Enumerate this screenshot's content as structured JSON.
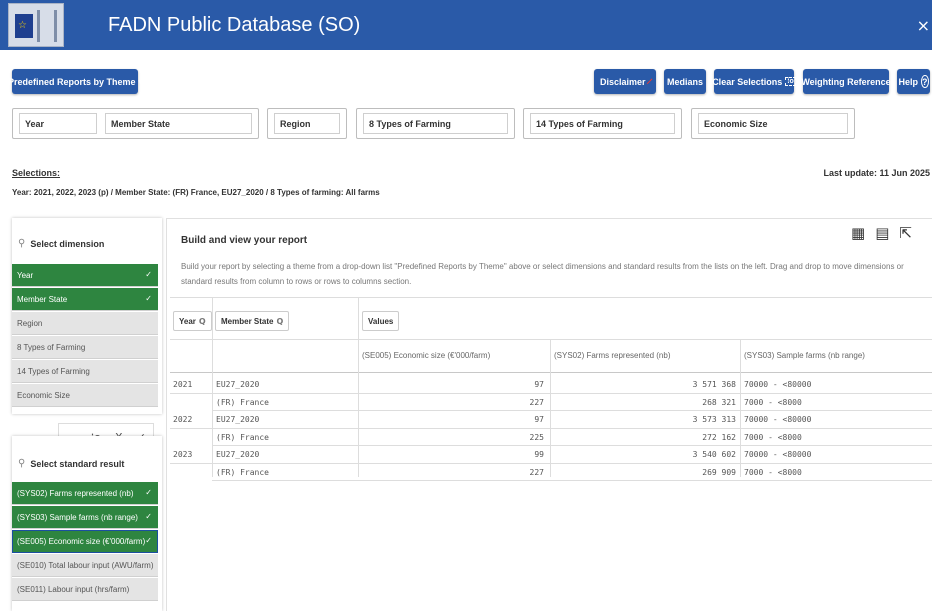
{
  "app": {
    "title": "FADN Public Database (SO)",
    "close": "×"
  },
  "toolbar": {
    "predefined": "Predefined Reports by Theme",
    "disclaimer": "Disclaimer",
    "medians": "Medians",
    "clear": "Clear Selections",
    "weighting": "Weighting Reference",
    "help": "Help",
    "help_icon": "?",
    "caret": "▾",
    "clear_icon": "⁞o"
  },
  "filters": [
    "Year",
    "Member State",
    "Region",
    "8 Types of Farming",
    "14 Types of Farming",
    "Economic Size"
  ],
  "selections": {
    "label": "Selections:",
    "text": "Year: 2021, 2022, 2023 (p) / Member State: (FR) France, EU27_2020 / 8 Types of farming: All farms",
    "last_update": "Last update: 11 Jun 2025"
  },
  "dimensions": {
    "search_label": "Select dimension",
    "items": [
      {
        "label": "Year",
        "selected": true
      },
      {
        "label": "Member State",
        "selected": true
      },
      {
        "label": "Region",
        "selected": false
      },
      {
        "label": "8 Types of Farming",
        "selected": false
      },
      {
        "label": "14 Types of Farming",
        "selected": false
      },
      {
        "label": "Economic Size",
        "selected": false
      }
    ]
  },
  "mini_toolbar": {
    "more": "···",
    "select": "⁞o",
    "close": "X",
    "confirm": "✓"
  },
  "results": {
    "search_label": "Select standard result",
    "items": [
      {
        "label": "(SYS02) Farms represented (nb)",
        "selected": true
      },
      {
        "label": "(SYS03) Sample farms (nb range)",
        "selected": true
      },
      {
        "label": "(SE005) Economic size (€'000/farm)",
        "selected": true
      },
      {
        "label": "(SE010) Total labour input (AWU/farm)",
        "selected": false
      },
      {
        "label": "(SE011) Labour input (hrs/farm)",
        "selected": false
      }
    ]
  },
  "report": {
    "title": "Build and view your report",
    "description": "Build your report by selecting a theme from a drop-down list \"Predefined Reports by Theme\" above or select dimensions and standard results from the lists on the left. Drag and drop to move dimensions or standard results from column to rows or rows to columns section.",
    "pills": {
      "year": "Year",
      "member_state": "Member State",
      "values": "Values"
    },
    "columns": [
      "(SE005) Economic size (€'000/farm)",
      "(SYS02) Farms represented (nb)",
      "(SYS03) Sample farms (nb range)"
    ],
    "rows": [
      {
        "year": "2021",
        "state": "EU27_2020",
        "se005": "97",
        "sys02": "3 571 368",
        "sys03": "70000 - <80000"
      },
      {
        "year": "",
        "state": "(FR) France",
        "se005": "227",
        "sys02": "268 321",
        "sys03": "7000 - <8000"
      },
      {
        "year": "2022",
        "state": "EU27_2020",
        "se005": "97",
        "sys02": "3 573 313",
        "sys03": "70000 - <80000"
      },
      {
        "year": "",
        "state": "(FR) France",
        "se005": "225",
        "sys02": "272 162",
        "sys03": "7000 - <8000"
      },
      {
        "year": "2023",
        "state": "EU27_2020",
        "se005": "99",
        "sys02": "3 540 602",
        "sys03": "70000 - <80000"
      },
      {
        "year": "",
        "state": "(FR) France",
        "se005": "227",
        "sys02": "269 909",
        "sys03": "7000 - <8000"
      }
    ]
  },
  "icons": {
    "search": "⚲",
    "magnifier": "Q",
    "table_a": "▦",
    "table_b": "▤",
    "export": "⇱"
  }
}
